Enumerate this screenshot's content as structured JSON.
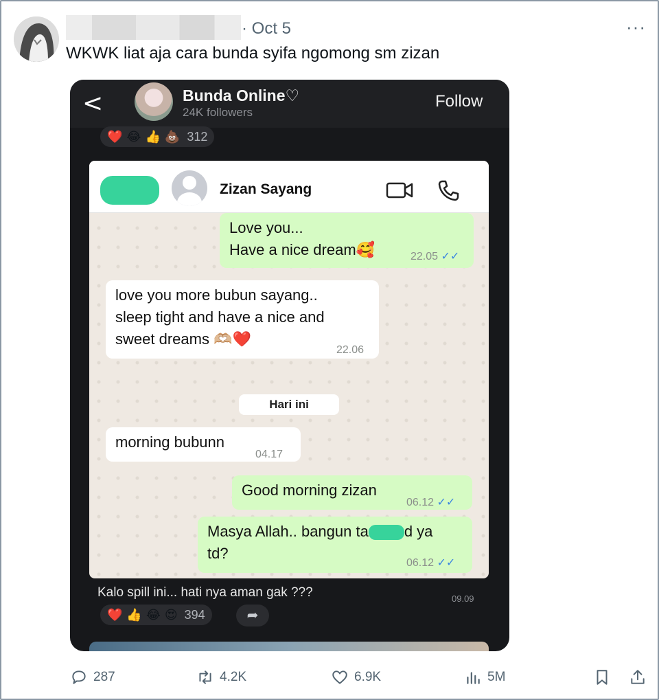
{
  "post": {
    "date": "· Oct 5",
    "more_label": "···",
    "text": "WKWK liat aja cara bunda syifa ngomong sm zizan"
  },
  "channel": {
    "back_label": "<",
    "name": "Bunda Online♡",
    "followers": "24K followers",
    "follow_label": "Follow",
    "top_reactions": [
      "❤️",
      "😂",
      "👍",
      "💩"
    ],
    "top_reaction_count": "312",
    "caption": "Kalo spill ini... hati nya aman gak ???",
    "caption_time": "09.09",
    "bottom_reactions": [
      "❤️",
      "👍",
      "😂",
      "😍"
    ],
    "bottom_reaction_count": "394",
    "share_label": "➦"
  },
  "chat": {
    "contact_name": "Zizan Sayang",
    "day_separator": "Hari ini",
    "messages": [
      {
        "dir": "out",
        "line1": "Love you...",
        "line2": "Have a nice dream🥰",
        "time": "22.05",
        "ticks": "✓✓"
      },
      {
        "dir": "in",
        "line1": "love you more bubun sayang..",
        "line2": "sleep tight and have a nice and",
        "line3": "sweet dreams 🫶🏼❤️",
        "time": "22.06"
      },
      {
        "dir": "in",
        "line1": "morning bubunn",
        "time": "04.17"
      },
      {
        "dir": "out",
        "line1": "Good morning zizan",
        "time": "06.12",
        "ticks": "✓✓"
      },
      {
        "dir": "out",
        "line1": "Masya Allah.. bangun ta",
        "line1b": "d ya",
        "line2": "td?",
        "time": "06.12",
        "ticks": "✓✓"
      }
    ]
  },
  "actions": {
    "replies": "287",
    "reposts": "4.2K",
    "likes": "6.9K",
    "views": "5M"
  },
  "colors": {
    "accent_tick": "#3c86e0",
    "outgoing_bubble": "#d6fbc4",
    "redaction_green": "#37d39b"
  }
}
